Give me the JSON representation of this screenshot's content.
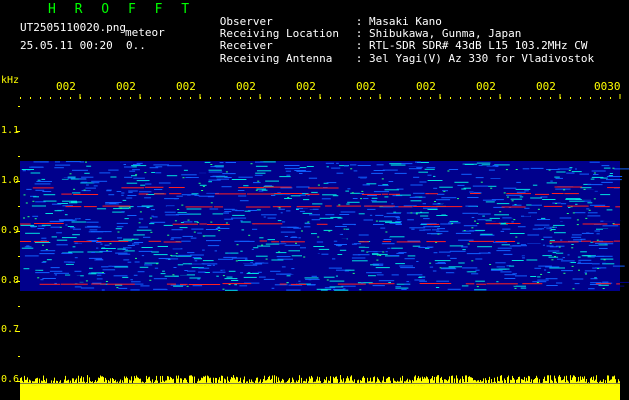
{
  "header": {
    "app_title": "H R O F F T",
    "filename": "UT2505110020.png",
    "mode": "meteor",
    "datetime": "25.05.11 00:20  0..",
    "fields": [
      {
        "label": "Observer",
        "sep": ": ",
        "value": "Masaki Kano"
      },
      {
        "label": "Receiving Location",
        "sep": ": ",
        "value": "Shibukawa, Gunma, Japan"
      },
      {
        "label": "Receiver",
        "sep": ": ",
        "value": "RTL-SDR SDR# 43dB L15 103.2MHz CW"
      },
      {
        "label": "Receiving Antenna",
        "sep": ": ",
        "value": "3el Yagi(V) Az 330 for Vladivostok"
      }
    ]
  },
  "axis": {
    "unit": "kHz",
    "y_labels": [
      "1.1",
      "1.0",
      "0.9",
      "0.8",
      "0.7",
      "0.6"
    ],
    "time_labels": [
      "002",
      "002",
      "002",
      "002",
      "002",
      "002",
      "002",
      "002",
      "002",
      "0030"
    ]
  },
  "colors": {
    "title": "#00ff00",
    "text": "#ffffff",
    "axis": "#ffff00",
    "background": "#000000",
    "spectrum_floor": "#00008c",
    "spectrum_mid": "#1060ff",
    "spectrum_high": "#00e0e0",
    "spectrum_signal": "#ff2020",
    "power_bar": "#ffff00"
  },
  "spectrogram": {
    "freq_range_khz": [
      0.6,
      1.15
    ],
    "band_khz": [
      0.78,
      1.04
    ],
    "signal_lines_khz": [
      0.988,
      0.975,
      0.95,
      0.915,
      0.88,
      0.795
    ]
  }
}
